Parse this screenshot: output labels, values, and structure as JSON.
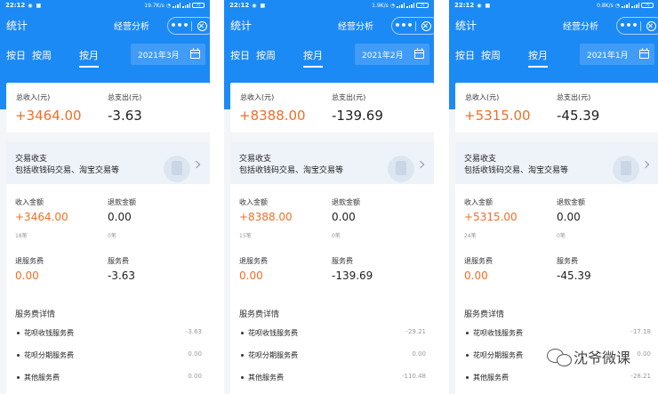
{
  "panels": [
    {
      "status": {
        "time": "22:12",
        "speed": "19.7K/s",
        "battery": "75"
      },
      "nav": {
        "title": "统计",
        "center": "经营分析"
      },
      "tabs": [
        "按日",
        "按周",
        "按月"
      ],
      "active_tab": 2,
      "date": "2021年3月",
      "summary": {
        "income_label": "总收入(元)",
        "income": "+3464.00",
        "expense_label": "总支出(元)",
        "expense": "-3.63"
      },
      "banner": {
        "title": "交易收支",
        "subtitle": "包括收钱码交易、淘宝交易等"
      },
      "income": {
        "label": "收入金额",
        "value": "+3464.00",
        "count": "18笔"
      },
      "refund": {
        "label": "退款金额",
        "value": "0.00",
        "count": "0笔"
      },
      "refund_fee": {
        "label": "退服务费",
        "value": "0.00"
      },
      "fee": {
        "label": "服务费",
        "value": "-3.63"
      },
      "fee_detail_title": "服务费详情",
      "fee_items": [
        {
          "name": "花呗收钱服务费",
          "amount": "-3.63"
        },
        {
          "name": "花呗分期服务费",
          "amount": "0.00"
        },
        {
          "name": "其他服务费",
          "amount": "0.00"
        }
      ]
    },
    {
      "status": {
        "time": "22:12",
        "speed": "1.9K/s",
        "battery": "75"
      },
      "nav": {
        "title": "统计",
        "center": "经营分析"
      },
      "tabs": [
        "按日",
        "按周",
        "按月"
      ],
      "active_tab": 2,
      "date": "2021年2月",
      "summary": {
        "income_label": "总收入(元)",
        "income": "+8388.00",
        "expense_label": "总支出(元)",
        "expense": "-139.69"
      },
      "banner": {
        "title": "交易收支",
        "subtitle": "包括收钱码交易、淘宝交易等"
      },
      "income": {
        "label": "收入金额",
        "value": "+8388.00",
        "count": "15笔"
      },
      "refund": {
        "label": "退款金额",
        "value": "0.00",
        "count": "0笔"
      },
      "refund_fee": {
        "label": "退服务费",
        "value": "0.00"
      },
      "fee": {
        "label": "服务费",
        "value": "-139.69"
      },
      "fee_detail_title": "服务费详情",
      "fee_items": [
        {
          "name": "花呗收钱服务费",
          "amount": "-29.21"
        },
        {
          "name": "花呗分期服务费",
          "amount": "0.00"
        },
        {
          "name": "其他服务费",
          "amount": "-110.48"
        }
      ]
    },
    {
      "status": {
        "time": "22:12",
        "speed": "0.8K/s",
        "battery": "75"
      },
      "nav": {
        "title": "统计",
        "center": "经营分析"
      },
      "tabs": [
        "按日",
        "按周",
        "按月"
      ],
      "active_tab": 2,
      "date": "2021年1月",
      "summary": {
        "income_label": "总收入(元)",
        "income": "+5315.00",
        "expense_label": "总支出(元)",
        "expense": "-45.39"
      },
      "banner": {
        "title": "交易收支",
        "subtitle": "包括收钱码交易、淘宝交易等"
      },
      "income": {
        "label": "收入金额",
        "value": "+5315.00",
        "count": "24笔"
      },
      "refund": {
        "label": "退款金额",
        "value": "0.00",
        "count": "0笔"
      },
      "refund_fee": {
        "label": "退服务费",
        "value": "0.00"
      },
      "fee": {
        "label": "服务费",
        "value": "-45.39"
      },
      "fee_detail_title": "服务费详情",
      "fee_items": [
        {
          "name": "花呗收钱服务费",
          "amount": "-17.18"
        },
        {
          "name": "花呗分期服务费",
          "amount": "0.00"
        },
        {
          "name": "其他服务费",
          "amount": "-28.21"
        }
      ]
    }
  ],
  "watermark": {
    "text": "沈爷微课",
    "icon": "wechat-icon"
  },
  "colors": {
    "header_blue": "#1c8af5",
    "income_orange": "#f16e24",
    "page_bg": "#f3f5f8"
  }
}
